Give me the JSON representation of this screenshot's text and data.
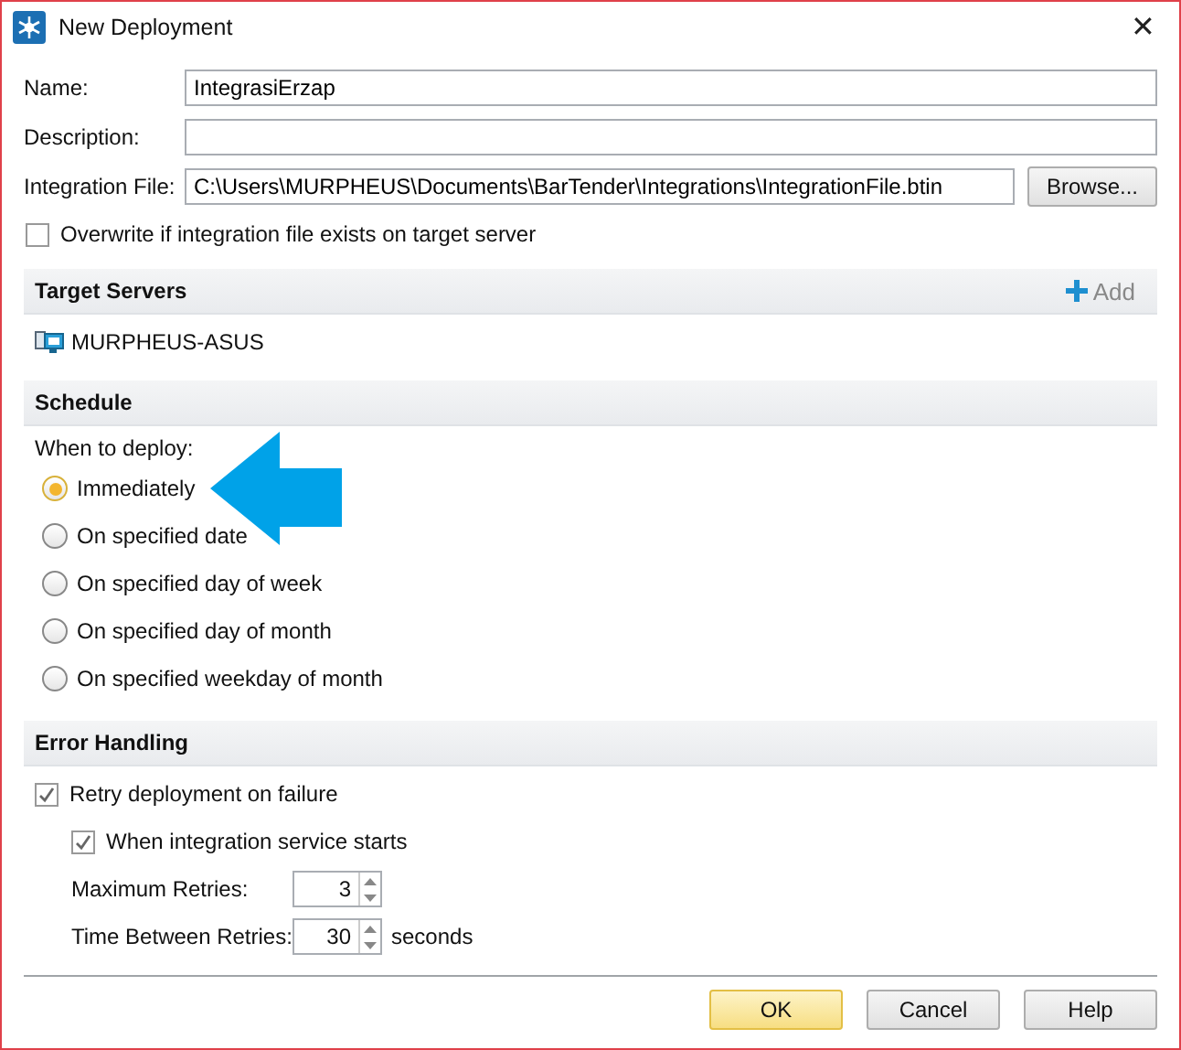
{
  "window": {
    "title": "New Deployment",
    "close": "✕"
  },
  "fields": [
    {
      "label": "Name:",
      "value": "IntegrasiErzap"
    },
    {
      "label": "Description:"
    },
    {
      "label": "Integration File:",
      "value": "C:\\Users\\MURPHEUS\\Documents\\BarTender\\Integrations\\IntegrationFile.btin",
      "button": "Browse..."
    }
  ],
  "overwrite": {
    "label": "Overwrite if integration file exists on target server",
    "checked": false
  },
  "target_servers": {
    "title": "Target Servers",
    "add": "Add",
    "servers": [
      "MURPHEUS-ASUS"
    ]
  },
  "schedule": {
    "title": "Schedule",
    "prompt": "When to deploy:",
    "options": [
      {
        "label": "Immediately",
        "selected": true
      },
      {
        "label": "On specified date",
        "selected": false
      },
      {
        "label": "On specified day of week",
        "selected": false
      },
      {
        "label": "On specified day of month",
        "selected": false
      },
      {
        "label": "On specified weekday of month",
        "selected": false
      }
    ]
  },
  "error_handling": {
    "title": "Error Handling",
    "retry": {
      "label": "Retry deployment on failure",
      "checked": true
    },
    "on_start": {
      "label": "When integration service starts",
      "checked": true
    },
    "max_retries": {
      "label": "Maximum Retries:",
      "value": "3"
    },
    "time_between": {
      "label": "Time Between Retries:",
      "value": "30",
      "unit": "seconds"
    }
  },
  "buttons": [
    {
      "label": "OK",
      "default": true
    },
    {
      "label": "Cancel",
      "default": false
    },
    {
      "label": "Help",
      "default": false
    }
  ]
}
